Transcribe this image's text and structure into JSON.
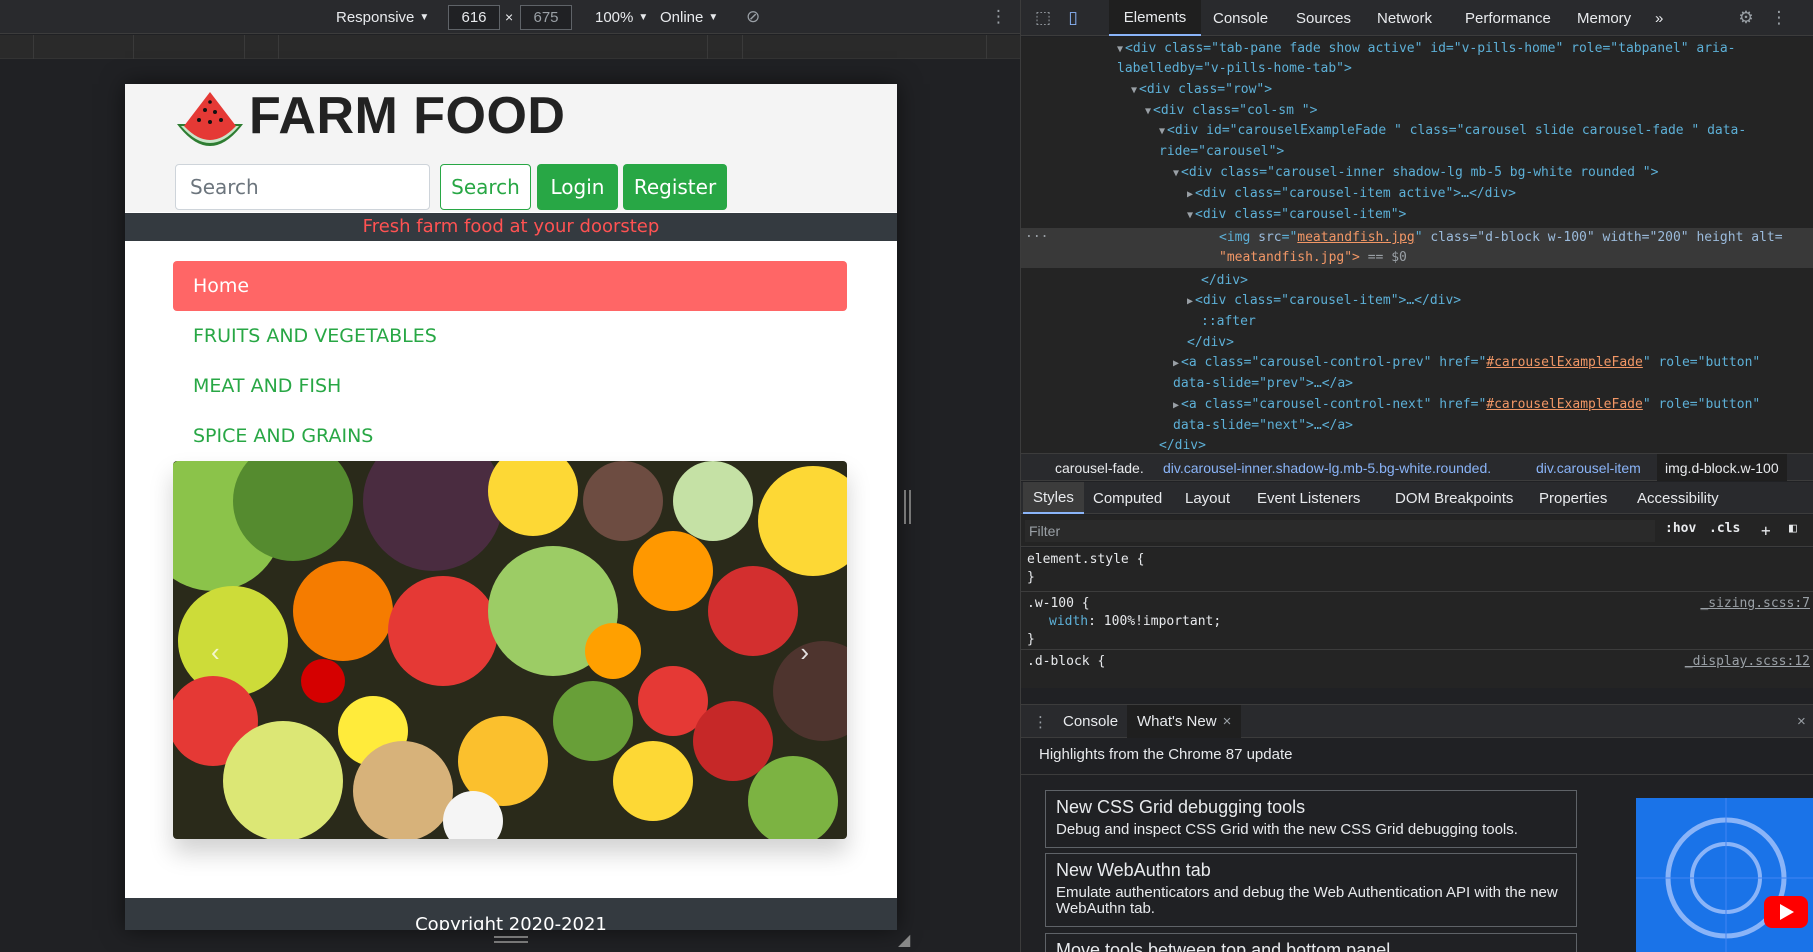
{
  "device_toolbar": {
    "device": "Responsive",
    "width": "616",
    "times": "×",
    "height": "675",
    "zoom": "100%",
    "throttle": "Online"
  },
  "site": {
    "title": "FARM FOOD",
    "search_placeholder": "Search",
    "search_button": "Search",
    "login_button": "Login",
    "register_button": "Register",
    "tagline": "Fresh farm food at your doorstep",
    "nav": [
      "Home",
      "FRUITS AND VEGETABLES",
      "MEAT AND FISH",
      "SPICE AND GRAINS"
    ],
    "carousel_prev": "‹",
    "carousel_next": "›",
    "footer": "Copyright 2020-2021",
    "colors": {
      "green": "#28a745",
      "active_nav": "#ff6666",
      "dark": "#343a40",
      "tagline_text": "#ff5252"
    }
  },
  "devtools": {
    "tabs": [
      "Elements",
      "Console",
      "Sources",
      "Network",
      "Performance",
      "Memory"
    ],
    "more_tabs": "»",
    "elements_lines": {
      "l1a": "<div class=\"tab-pane fade show active\" id=\"v-pills-home\" role=\"tabpanel\" aria-",
      "l1b": "labelledby=\"v-pills-home-tab\">",
      "l2": "<div class=\"row\">",
      "l3": "<div class=\"col-sm \">",
      "l4a": "<div id=\"carouselExampleFade \" class=\"carousel slide carousel-fade \" data-",
      "l4b": "ride=\"carousel\">",
      "l5": "<div class=\"carousel-inner shadow-lg mb-5 bg-white rounded \">",
      "l6": "<div class=\"carousel-item active\">…</div>",
      "l7": "<div class=\"carousel-item\">",
      "l8_src": "meatandfish.jpg",
      "l8_rest": "class=\"d-block w-100\" width=\"200\" height alt=",
      "l8b": "\"meatandfish.jpg\">",
      "l8_eq": "== $0",
      "l9": "</div>",
      "l10": "<div class=\"carousel-item\">…</div>",
      "l11": "::after",
      "l12": "</div>",
      "l13_href": "#carouselExampleFade",
      "l13a": "<a class=\"carousel-control-prev\" href=",
      "l13c": " role=\"button\"",
      "l13b": "data-slide=\"prev\">…</a>",
      "l14a": "<a class=\"carousel-control-next\" href=",
      "l14c": " role=\"button\"",
      "l14b": "data-slide=\"next\">…</a>",
      "l15": "</div>",
      "ellipsis": "..."
    },
    "breadcrumbs": [
      "carousel-fade.",
      "div.carousel-inner.shadow-lg.mb-5.bg-white.rounded.",
      "div.carousel-item",
      "img.d-block.w-100"
    ],
    "sub_tabs": [
      "Styles",
      "Computed",
      "Layout",
      "Event Listeners",
      "DOM Breakpoints",
      "Properties",
      "Accessibility"
    ],
    "filter_placeholder": "Filter",
    "hov": ":hov",
    "cls": ".cls",
    "styles": {
      "r1_sel": "element.style {",
      "r1_close": "}",
      "r2_sel": ".w-100 {",
      "r2_prop": "width",
      "r2_val": ": 100%!important;",
      "r2_close": "}",
      "r2_src": "_sizing.scss:7",
      "r3_sel": ".d-block {",
      "r3_src": "_display.scss:12"
    },
    "drawer_tabs": [
      "Console",
      "What's New"
    ],
    "whats_new": {
      "heading": "Highlights from the Chrome 87 update",
      "cards": [
        {
          "title": "New CSS Grid debugging tools",
          "desc": "Debug and inspect CSS Grid with the new CSS Grid debugging tools."
        },
        {
          "title": "New WebAuthn tab",
          "desc": "Emulate authenticators and debug the Web Authentication API with the new WebAuthn tab."
        },
        {
          "title": "Move tools between top and bottom panel",
          "desc": ""
        }
      ]
    }
  }
}
